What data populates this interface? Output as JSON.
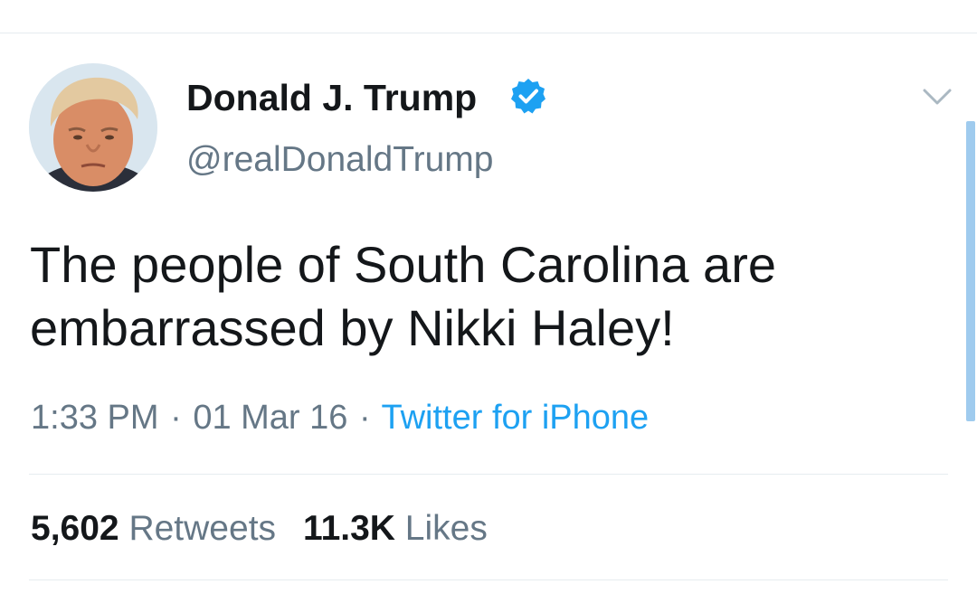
{
  "tweet": {
    "author": {
      "display_name": "Donald J. Trump",
      "handle": "@realDonaldTrump",
      "verified": true,
      "avatar_icon": "profile-photo"
    },
    "text": "The people of South Carolina are\nembarrassed by Nikki Haley!",
    "timestamp": "1:33 PM",
    "date": "01 Mar 16",
    "separator": "·",
    "source": "Twitter for iPhone",
    "stats": {
      "retweets_count": "5,602",
      "retweets_label": "Retweets",
      "likes_count": "11.3K",
      "likes_label": "Likes"
    },
    "menu_icon": "chevron-down-icon"
  },
  "colors": {
    "text_primary": "#14171a",
    "text_secondary": "#657786",
    "link_blue": "#1da1f2",
    "divider": "#e6ecf0",
    "scrollbar": "#9fcbee"
  }
}
